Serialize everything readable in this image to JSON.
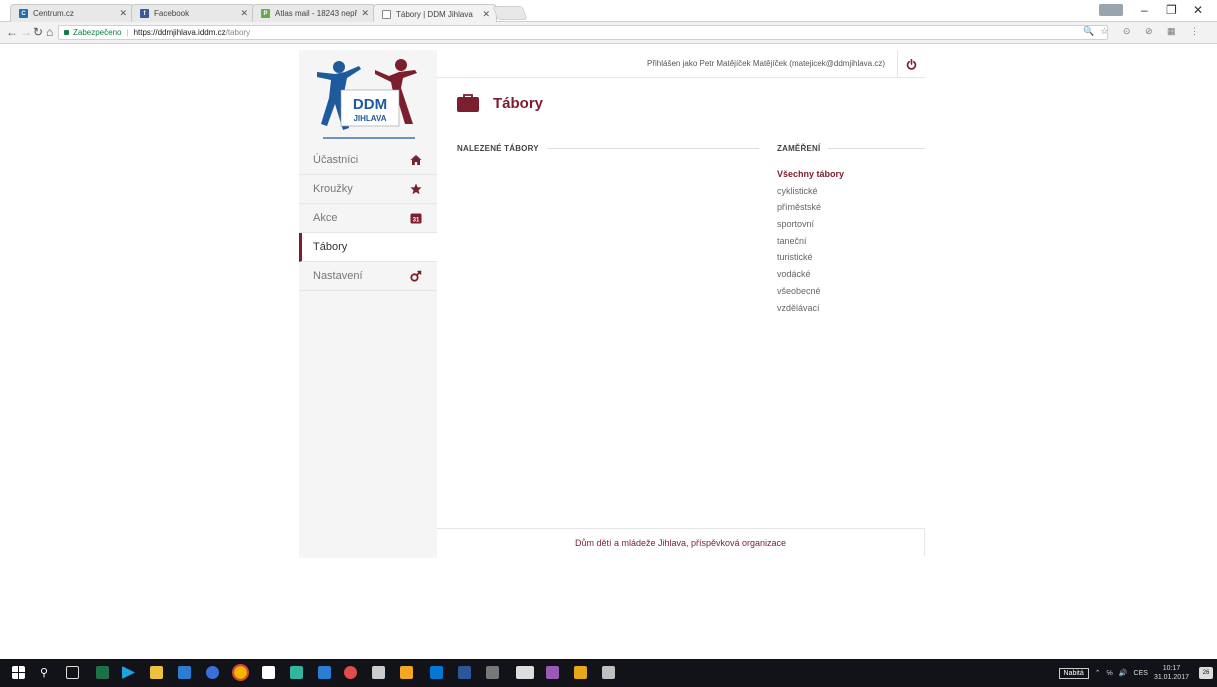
{
  "browser": {
    "tabs": [
      {
        "title": "Centrum.cz",
        "fav_color": "#2a6bb0",
        "fav_glyph": "C"
      },
      {
        "title": "Facebook",
        "fav_color": "#3b5998",
        "fav_glyph": "f"
      },
      {
        "title": "Atlas mail - 18243 nepřeč",
        "fav_color": "#6aa84f",
        "fav_glyph": "P"
      },
      {
        "title": "Tábory | DDM Jihlava",
        "fav_color": "#ffffff",
        "fav_glyph": ""
      }
    ],
    "secure_label": "Zabezpečeno",
    "url_host": "https://ddmjihlava.iddm.cz",
    "url_path": "/tabory"
  },
  "header": {
    "user_text": "Přihlášen jako Petr Matějíček Matějíček (matejicek@ddmjihlava.cz)"
  },
  "logo": {
    "line1": "DDM",
    "line2": "JIHLAVA"
  },
  "sidebar": {
    "items": [
      {
        "label": "Účastníci",
        "icon": "home-icon"
      },
      {
        "label": "Kroužky",
        "icon": "star-icon"
      },
      {
        "label": "Akce",
        "icon": "calendar-icon",
        "badge": "31"
      },
      {
        "label": "Tábory",
        "icon": "",
        "active": true
      },
      {
        "label": "Nastavení",
        "icon": "gender-icon"
      }
    ]
  },
  "main": {
    "title": "Tábory",
    "found_title": "NALEZENÉ TÁBORY",
    "focus_title": "ZAMĚŘENÍ",
    "filters": [
      "Všechny tábory",
      "cyklistické",
      "příměstské",
      "sportovní",
      "taneční",
      "turistické",
      "vodácké",
      "všeobecné",
      "vzdělávací"
    ],
    "active_filter": 0
  },
  "footer": {
    "text": "Dům dětí a mládeže Jihlava, příspěvková organizace"
  },
  "taskbar": {
    "battery_label": "Nabitá",
    "lang": "CES",
    "time": "10:17",
    "date": "31.01.2017",
    "notification_count": "26"
  },
  "colors": {
    "brand": "#7b1e2e",
    "logo_blue": "#1f5a9c"
  }
}
